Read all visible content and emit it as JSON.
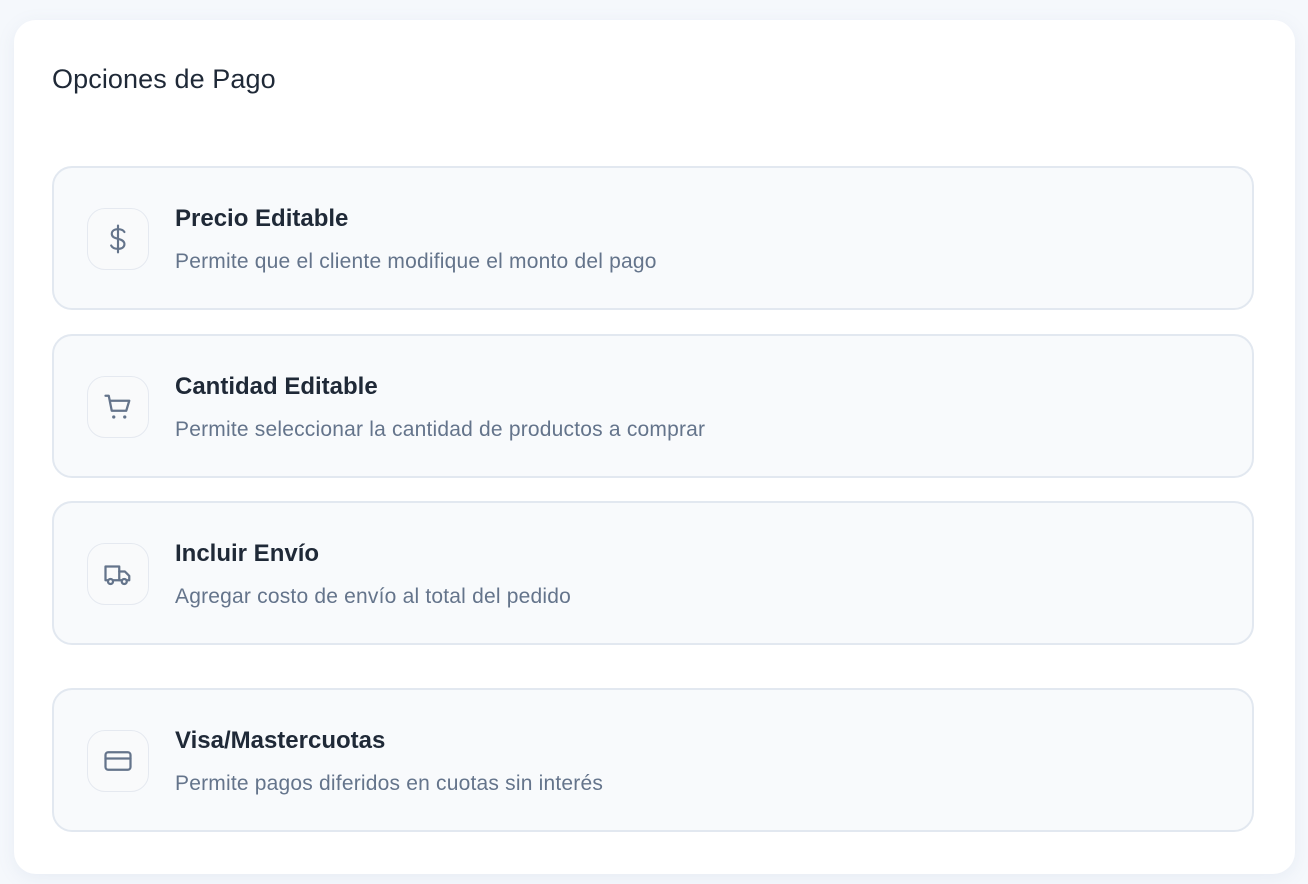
{
  "panel": {
    "title": "Opciones de Pago"
  },
  "options": [
    {
      "title": "Precio Editable",
      "description": "Permite que el cliente modifique el monto del pago",
      "icon": "dollar-icon"
    },
    {
      "title": "Cantidad Editable",
      "description": "Permite seleccionar la cantidad de productos a comprar",
      "icon": "shopping-cart-icon"
    },
    {
      "title": "Incluir Envío",
      "description": "Agregar costo de envío al total del pedido",
      "icon": "truck-icon"
    },
    {
      "title": "Visa/Mastercuotas",
      "description": "Permite pagos diferidos en cuotas sin interés",
      "icon": "credit-card-icon"
    }
  ],
  "colors": {
    "title": "#1f2937",
    "description": "#64748b",
    "icon": "#64748b",
    "option_background": "#f8fafc",
    "option_border": "#e2e8f0"
  }
}
